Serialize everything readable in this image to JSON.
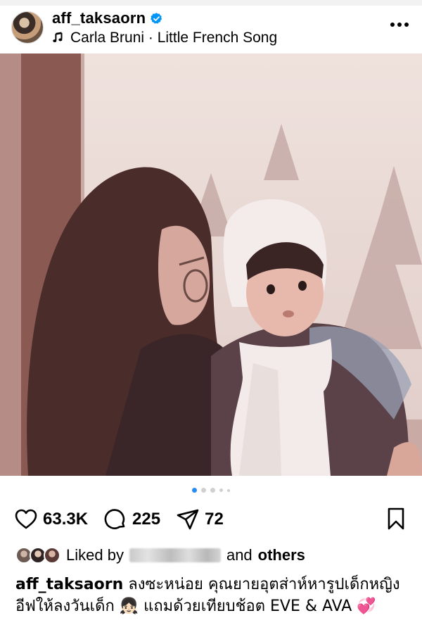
{
  "post": {
    "username": "aff_taksaorn",
    "verified": true,
    "song": "Carla Bruni · Little French Song"
  },
  "carousel": {
    "total_dots": 5,
    "active_index": 0
  },
  "actions": {
    "likes": "63.3K",
    "comments": "225",
    "shares": "72"
  },
  "liked_by": {
    "prefix": "Liked by",
    "connector": "and",
    "others": "others"
  },
  "caption": {
    "username": "aff_taksaorn",
    "text": "ลงซะหน่อย คุณยายอุตส่าห์หารูปเด็กหญิงอีฟให้ลงวันเด็ก 👧🏻 แถมด้วยเทียบช้อต EVE & AVA 💞"
  },
  "colors": {
    "verified_badge": "#0095f6",
    "active_dot": "#2a8cf0"
  },
  "icons": [
    "verified-icon",
    "music-note-icon",
    "more-icon",
    "user-tag-icon",
    "mute-icon",
    "heart-icon",
    "comment-icon",
    "share-icon",
    "bookmark-icon"
  ]
}
